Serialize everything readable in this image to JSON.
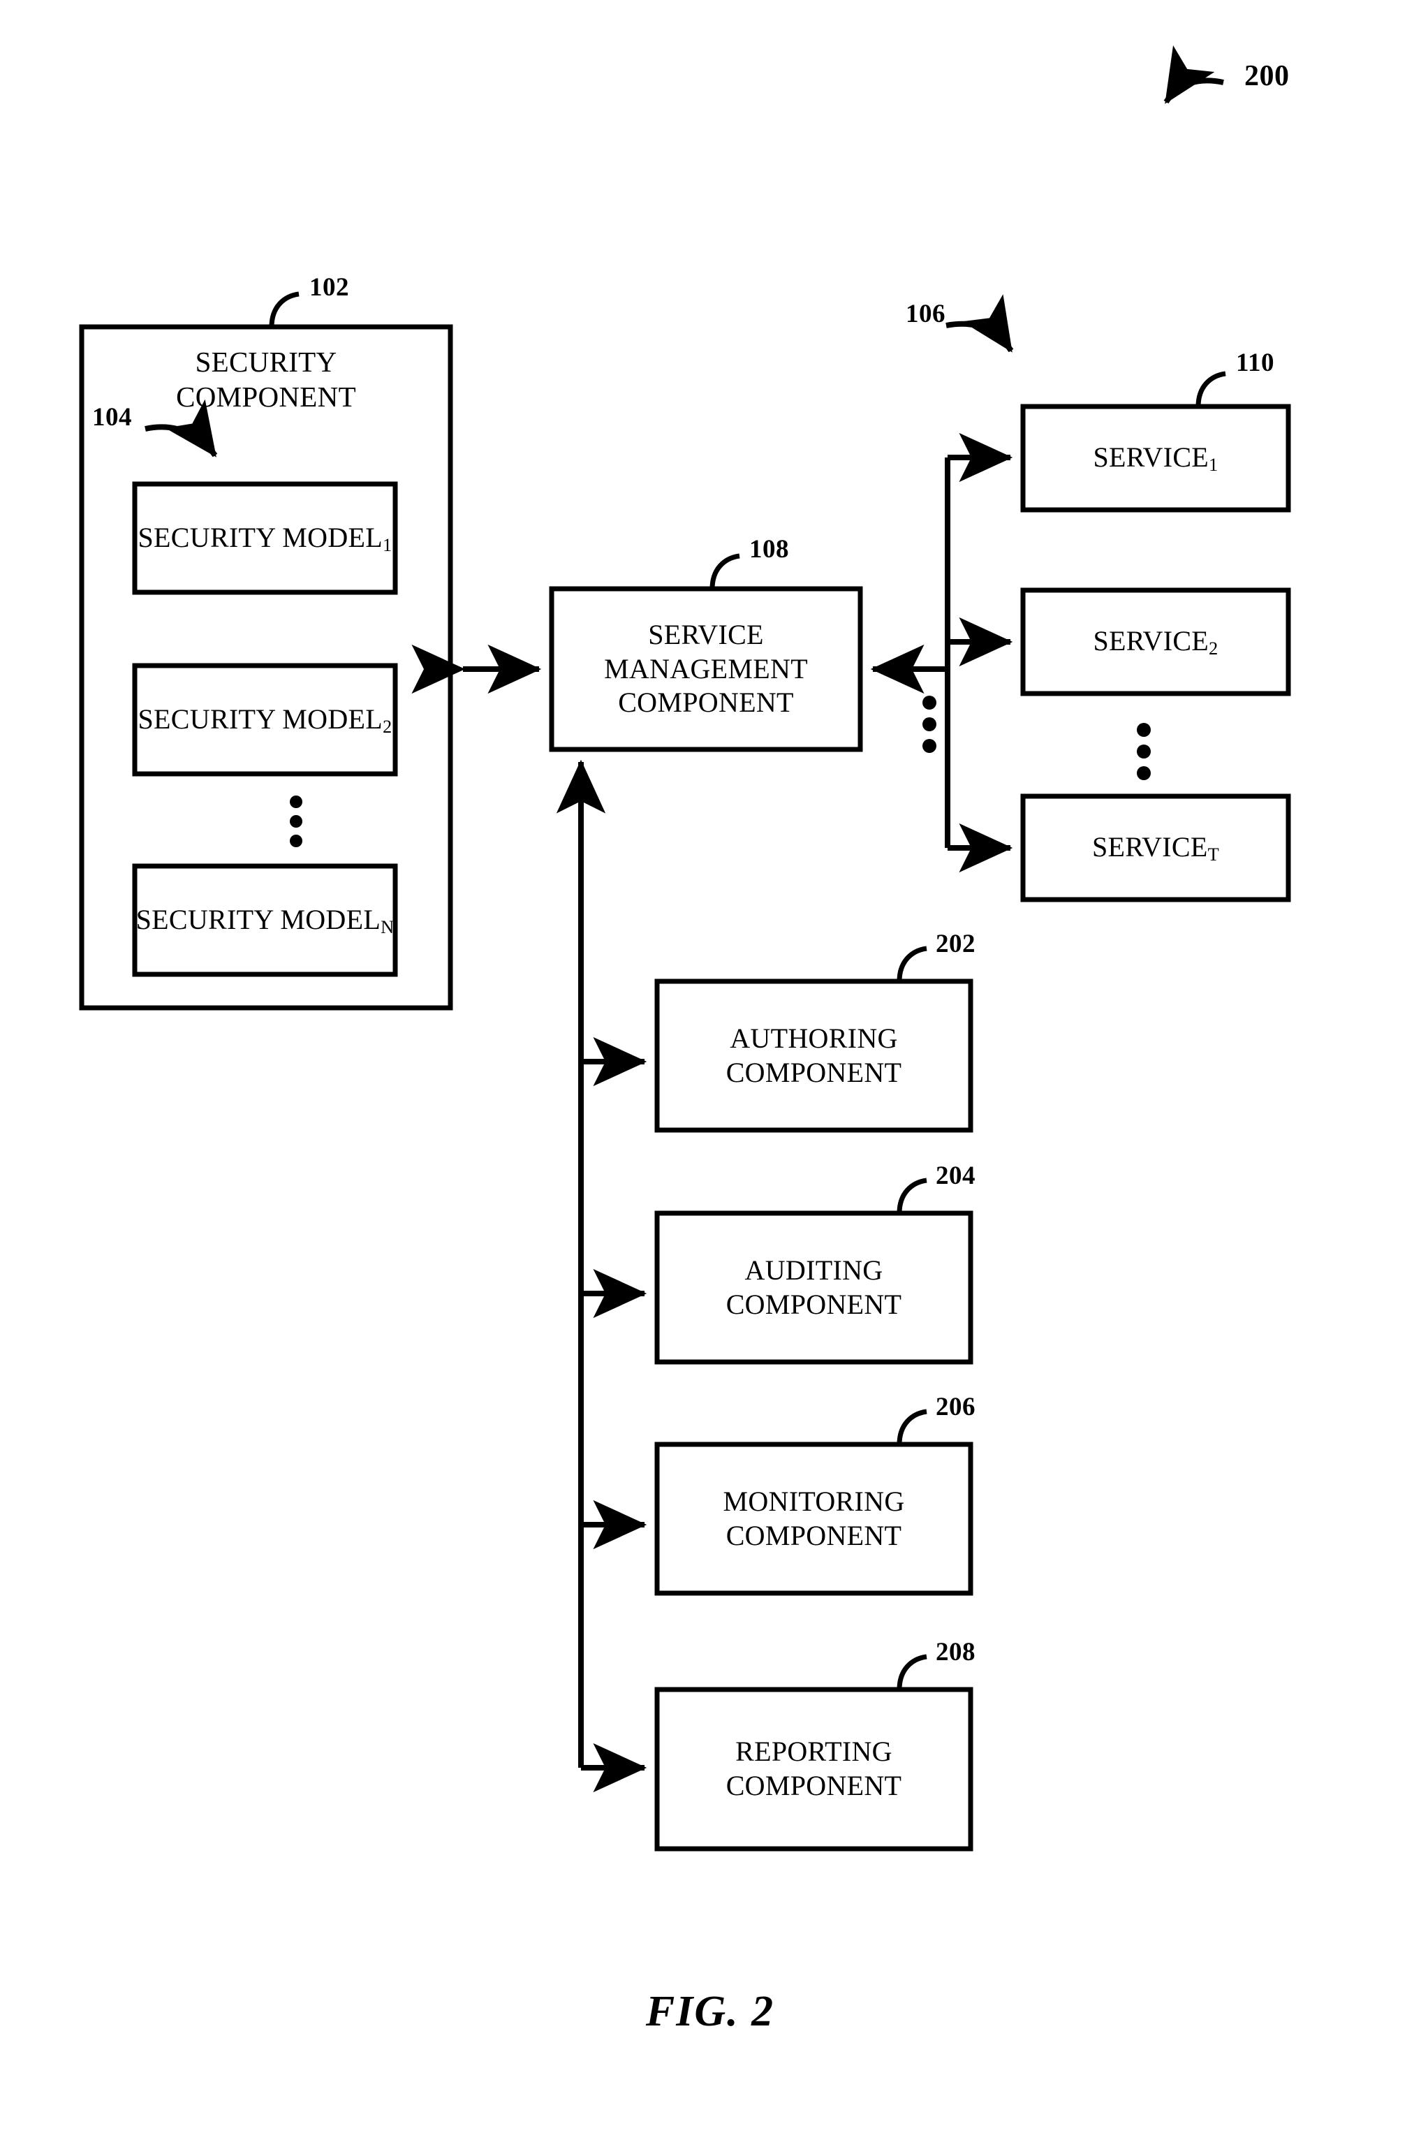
{
  "figure": {
    "caption": "FIG. 2",
    "diagram_ref": "200"
  },
  "boxes": {
    "security_component": {
      "label": "SECURITY\nCOMPONENT",
      "ref": "102"
    },
    "security_models_group": {
      "ref": "104"
    },
    "security_model_1": {
      "text": "SECURITY MODEL",
      "sub": "1"
    },
    "security_model_2": {
      "text": "SECURITY MODEL",
      "sub": "2"
    },
    "security_model_n": {
      "text": "SECURITY MODEL",
      "sub": "N"
    },
    "service_management_component": {
      "label": "SERVICE\nMANAGEMENT\nCOMPONENT",
      "ref": "108"
    },
    "services_group": {
      "ref": "106"
    },
    "service_1": {
      "text": "SERVICE",
      "sub": "1",
      "ref": "110"
    },
    "service_2": {
      "text": "SERVICE",
      "sub": "2"
    },
    "service_t": {
      "text": "SERVICE",
      "sub": "T"
    },
    "authoring_component": {
      "label": "AUTHORING\nCOMPONENT",
      "ref": "202"
    },
    "auditing_component": {
      "label": "AUDITING\nCOMPONENT",
      "ref": "204"
    },
    "monitoring_component": {
      "label": "MONITORING\nCOMPONENT",
      "ref": "206"
    },
    "reporting_component": {
      "label": "REPORTING\nCOMPONENT",
      "ref": "208"
    }
  },
  "ellipsis": {
    "security_models": "vertical-ellipsis",
    "service_bus": "vertical-ellipsis",
    "services": "vertical-ellipsis"
  },
  "colors": {
    "stroke": "#000000",
    "background": "#ffffff"
  }
}
